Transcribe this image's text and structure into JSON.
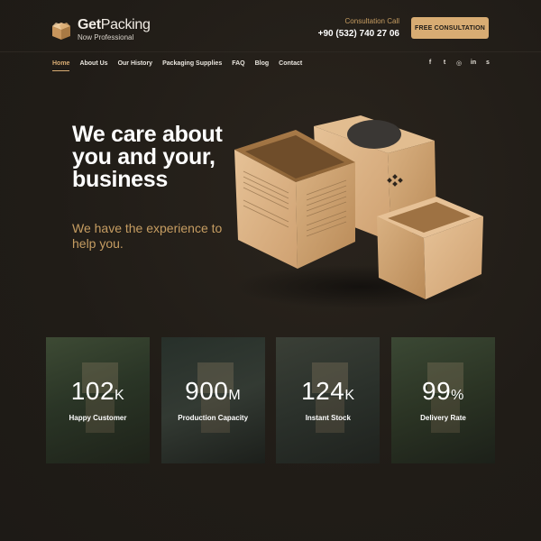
{
  "brand": {
    "name_bold": "Get",
    "name_rest": "Packing",
    "tagline": "Now Professional"
  },
  "consultation": {
    "label": "Consultation Call",
    "phone": "+90 (532) 740 27 06",
    "button_label": "FREE CONSULTATION"
  },
  "nav": {
    "items": [
      {
        "label": "Home",
        "active": true
      },
      {
        "label": "About Us",
        "active": false
      },
      {
        "label": "Our History",
        "active": false
      },
      {
        "label": "Packaging Supplies",
        "active": false
      },
      {
        "label": "FAQ",
        "active": false
      },
      {
        "label": "Blog",
        "active": false
      },
      {
        "label": "Contact",
        "active": false
      }
    ]
  },
  "social": [
    {
      "icon": "facebook-icon",
      "glyph": "f"
    },
    {
      "icon": "twitter-icon",
      "glyph": "t"
    },
    {
      "icon": "instagram-icon",
      "glyph": "◎"
    },
    {
      "icon": "linkedin-icon",
      "glyph": "in"
    },
    {
      "icon": "skype-icon",
      "glyph": "s"
    }
  ],
  "hero": {
    "title": "We care about you and your, business",
    "subtitle": "We have the experience to help you."
  },
  "stats": [
    {
      "value": "102",
      "unit": "K",
      "label": "Happy Customer"
    },
    {
      "value": "900",
      "unit": "M",
      "label": "Production Capacity"
    },
    {
      "value": "124",
      "unit": "K",
      "label": "Instant Stock"
    },
    {
      "value": "99",
      "unit": "%",
      "label": "Delivery Rate"
    }
  ],
  "colors": {
    "accent": "#d8ac73",
    "accent_text": "#c69d62",
    "background": "#201c17"
  }
}
